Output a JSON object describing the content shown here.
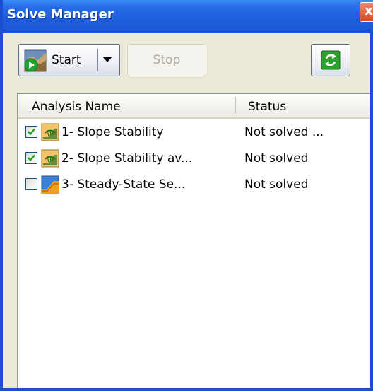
{
  "window": {
    "title": "Solve Manager",
    "close_label": "x"
  },
  "toolbar": {
    "start_label": "Start",
    "stop_label": "Stop",
    "icons": {
      "start": "play-analysis-icon",
      "dropdown": "chevron-down-icon",
      "refresh": "refresh-icon"
    }
  },
  "table": {
    "columns": [
      "Analysis Name",
      "Status"
    ],
    "rows": [
      {
        "checked": true,
        "icon": "slope-stability-icon",
        "name": "1- Slope Stability",
        "status": "Not solved  ..."
      },
      {
        "checked": true,
        "icon": "slope-stability-icon",
        "name": "2- Slope Stability av...",
        "status": "Not solved"
      },
      {
        "checked": false,
        "icon": "steady-state-seepage-icon",
        "name": "3- Steady-State Se...",
        "status": "Not solved"
      }
    ]
  },
  "colors": {
    "title_bar": "#1f5fdc",
    "check_mark": "#21a121",
    "refresh_green": "#2ea02e"
  }
}
